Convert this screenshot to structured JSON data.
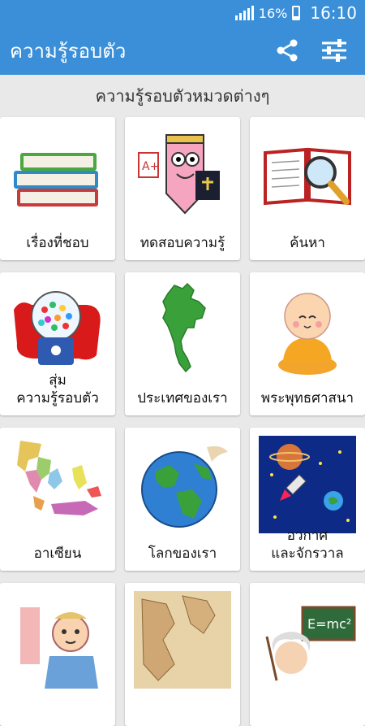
{
  "status": {
    "battery": "16%",
    "time": "16:10"
  },
  "appbar": {
    "title": "ความรู้รอบตัว",
    "share_icon": "share-icon",
    "settings_icon": "sliders-icon"
  },
  "subtitle": "ความรู้รอบตัวหมวดต่างๆ",
  "categories": [
    {
      "label": "เรื่องที่ชอบ",
      "icon": "books-icon"
    },
    {
      "label": "ทดสอบความรู้",
      "icon": "pencil-character-icon"
    },
    {
      "label": "ค้นหา",
      "icon": "book-magnifier-icon"
    },
    {
      "label": "สุ่ม\nความรู้รอบตัว",
      "icon": "gumball-machine-icon"
    },
    {
      "label": "ประเทศของเรา",
      "icon": "thailand-map-icon"
    },
    {
      "label": "พระพุทธศาสนา",
      "icon": "monk-icon"
    },
    {
      "label": "อาเซียน",
      "icon": "asean-map-icon"
    },
    {
      "label": "โลกของเรา",
      "icon": "globe-icon"
    },
    {
      "label": "อวกาศ\nและจักรวาล",
      "icon": "space-rocket-icon"
    },
    {
      "label": "",
      "icon": "anatomy-icon"
    },
    {
      "label": "",
      "icon": "old-map-icon"
    },
    {
      "label": "",
      "icon": "scientist-icon"
    }
  ]
}
